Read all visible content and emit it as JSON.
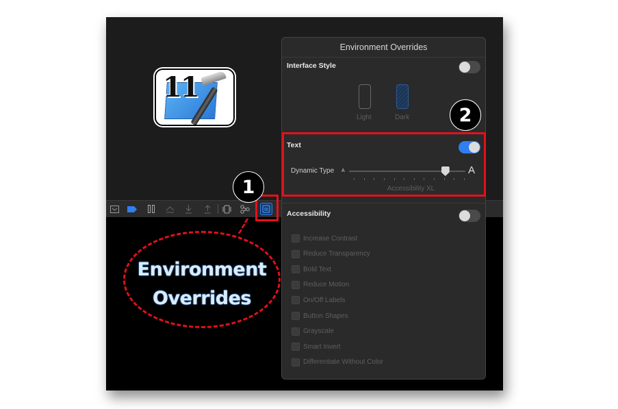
{
  "popover": {
    "title": "Environment Overrides",
    "interface_style": {
      "label": "Interface Style",
      "enabled": false,
      "options": [
        {
          "label": "Light",
          "icon": "phone-light-icon",
          "selected": false
        },
        {
          "label": "Dark",
          "icon": "phone-dark-icon",
          "selected": true
        }
      ]
    },
    "text": {
      "label": "Text",
      "enabled": true,
      "dynamic_type_label": "Dynamic Type",
      "small_a": "A",
      "large_a": "A",
      "slider_steps": 12,
      "slider_index": 9,
      "size_name": "Accessibility XL"
    },
    "accessibility": {
      "label": "Accessibility",
      "enabled": false,
      "options": [
        {
          "label": "Increase Contrast",
          "checked": false
        },
        {
          "label": "Reduce Transparency",
          "checked": false
        },
        {
          "label": "Bold Text",
          "checked": false
        },
        {
          "label": "Reduce Motion",
          "checked": false
        },
        {
          "label": "On/Off Labels",
          "checked": false
        },
        {
          "label": "Button Shapes",
          "checked": false
        },
        {
          "label": "Grayscale",
          "checked": false
        },
        {
          "label": "Smart Invert",
          "checked": false
        },
        {
          "label": "Differentiate Without Color",
          "checked": false
        }
      ]
    }
  },
  "toolbar": {
    "icons": [
      "hide-debug-area-icon",
      "breakpoint-icon",
      "pause-icon",
      "step-over-icon",
      "step-into-icon",
      "step-out-icon",
      "view-hierarchy-icon",
      "memory-graph-icon",
      "environment-overrides-icon"
    ],
    "active": "environment-overrides-icon"
  },
  "logo": {
    "version": "11",
    "name": "xcode-logo"
  },
  "annotations": {
    "badge_1": "1",
    "badge_2": "2",
    "callout_line1": "Environment",
    "callout_line2": "Overrides",
    "highlight_color": "#e5101a"
  },
  "colors": {
    "accent": "#2f7ff0",
    "panel": "#2a2a2a",
    "canvas": "#1c1c1c"
  }
}
